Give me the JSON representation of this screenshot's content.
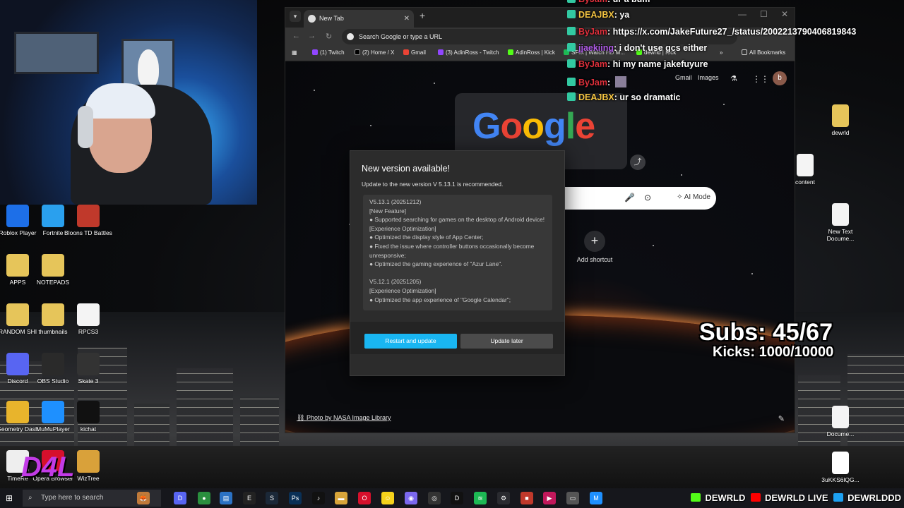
{
  "browser": {
    "tab_title": "New Tab",
    "omnibox_placeholder": "Search Google or type a URL",
    "bookmarks": [
      "(1) Twitch",
      "(2) Home / X",
      "Gmail",
      "(3) AdinRoss - Twitch",
      "AdinRoss | Kick",
      "SFlix | Watch HD M...",
      "dewrld | Kick"
    ],
    "all_bookmarks": "All Bookmarks",
    "top_links": [
      "Gmail",
      "Images"
    ],
    "avatar_letter": "b",
    "logo_text": "Google",
    "search_ai_mode": "AI Mode",
    "add_shortcut": "Add shortcut",
    "photo_credit": "Photo by NASA Image Library"
  },
  "dialog": {
    "title": "New version available!",
    "subtitle": "Update to the new version V 5.13.1 is recommended.",
    "notes": [
      "V5.13.1 (20251212)",
      "[New Feature]",
      "● Supported searching for games on the desktop of Android device!",
      "[Experience Optimization]",
      "● Optimized the display style of App Center;",
      "● Fixed the issue where controller buttons occasionally become unresponsive;",
      "● Optimized the gaming experience of \"Azur Lane\".",
      "",
      "V5.12.1 (20251205)",
      "[Experience Optimization]",
      "● Optimized the app experience of \"Google Calendar\";"
    ],
    "restart_label": "Restart and update",
    "later_label": "Update later"
  },
  "chat": [
    {
      "user": "ByJam",
      "color": "#e0303c",
      "msg": ": ur a bum"
    },
    {
      "user": "DEAJBX",
      "color": "#f5c542",
      "msg": ": ya"
    },
    {
      "user": "ByJam",
      "color": "#e0303c",
      "msg": ": https://x.com/JakeFuture27_/status/2002213790406819843"
    },
    {
      "user": "jjaekiing",
      "color": "#b05ce8",
      "msg": ": i don't use gcs either"
    },
    {
      "user": "ByJam",
      "color": "#e0303c",
      "msg": ": hi my name jakefuyure"
    },
    {
      "user": "ByJam",
      "color": "#e0303c",
      "msg": ": "
    },
    {
      "user": "DEAJBX",
      "color": "#f5c542",
      "msg": ": ur so dramatic"
    }
  ],
  "overlay": {
    "subs": "Subs: 45/67",
    "kicks": "Kicks: 1000/10000",
    "social": [
      "DEWRLD",
      "DEWRLD LIVE",
      "DEWRLDDD"
    ],
    "d4l": "D4L"
  },
  "desktop_icons_left": [
    {
      "label": "Roblox Player",
      "color": "#1d6fe8"
    },
    {
      "label": "Fortnite",
      "color": "#2aa0ee"
    },
    {
      "label": "Bloons TD Battles",
      "color": "#c0392b"
    },
    {
      "label": "APPS",
      "color": "#e6c55a"
    },
    {
      "label": "NOTEPADS",
      "color": "#e6c55a"
    },
    {
      "label": "RANDOM SHI",
      "color": "#e6c55a"
    },
    {
      "label": "thumbnails",
      "color": "#e6c55a"
    },
    {
      "label": "RPCS3",
      "color": "#f4f4f4"
    },
    {
      "label": "Discord",
      "color": "#5865f2"
    },
    {
      "label": "OBS Studio",
      "color": "#2a2a2a"
    },
    {
      "label": "Skate 3",
      "color": "#333"
    },
    {
      "label": "Geometry Dash",
      "color": "#e8b42c"
    },
    {
      "label": "MuMuPlayer",
      "color": "#1e90ff"
    },
    {
      "label": "kichat",
      "color": "#111"
    },
    {
      "label": "TimeRe",
      "color": "#eee"
    },
    {
      "label": "Opera Browser",
      "color": "#d6102c"
    },
    {
      "label": "WizTree",
      "color": "#d9a13a"
    }
  ],
  "desktop_icons_right": [
    {
      "label": "dewrld",
      "color": "#e6c55a"
    },
    {
      "label": "content",
      "color": "#f4f4f4"
    },
    {
      "label": "New Text Docume...",
      "color": "#f4f4f4"
    },
    {
      "label": "Docume...",
      "color": "#f4f4f4"
    },
    {
      "label": "3uKKS6lQG...",
      "color": "#ffffff"
    }
  ],
  "taskbar": {
    "search_placeholder": "Type here to search"
  }
}
